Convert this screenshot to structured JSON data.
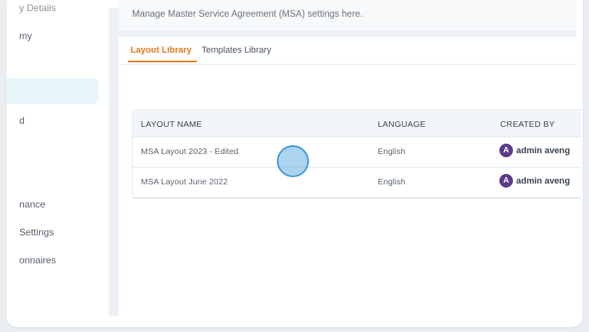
{
  "sidebar": {
    "items": [
      {
        "label": "y Details"
      },
      {
        "label": "my"
      },
      {
        "label": "d"
      },
      {
        "label": "nance"
      },
      {
        "label": "Settings"
      },
      {
        "label": "onnaires"
      }
    ]
  },
  "main": {
    "description": "Manage Master Service Agreement (MSA) settings here.",
    "tabs": [
      {
        "label": "Layout Library",
        "active": true
      },
      {
        "label": "Templates Library",
        "active": false
      }
    ],
    "table": {
      "columns": [
        "LAYOUT NAME",
        "LANGUAGE",
        "CREATED BY"
      ],
      "rows": [
        {
          "name": "MSA Layout 2023 - Edited",
          "language": "English",
          "created_by": "admin aveng",
          "avatar": "A"
        },
        {
          "name": "MSA Layout June 2022",
          "language": "English",
          "created_by": "admin aveng",
          "avatar": "A"
        }
      ]
    }
  },
  "colors": {
    "accent": "#e07b1f",
    "sidebar_active_bg": "#e8f6fa",
    "cursor": "#3f96d6"
  }
}
